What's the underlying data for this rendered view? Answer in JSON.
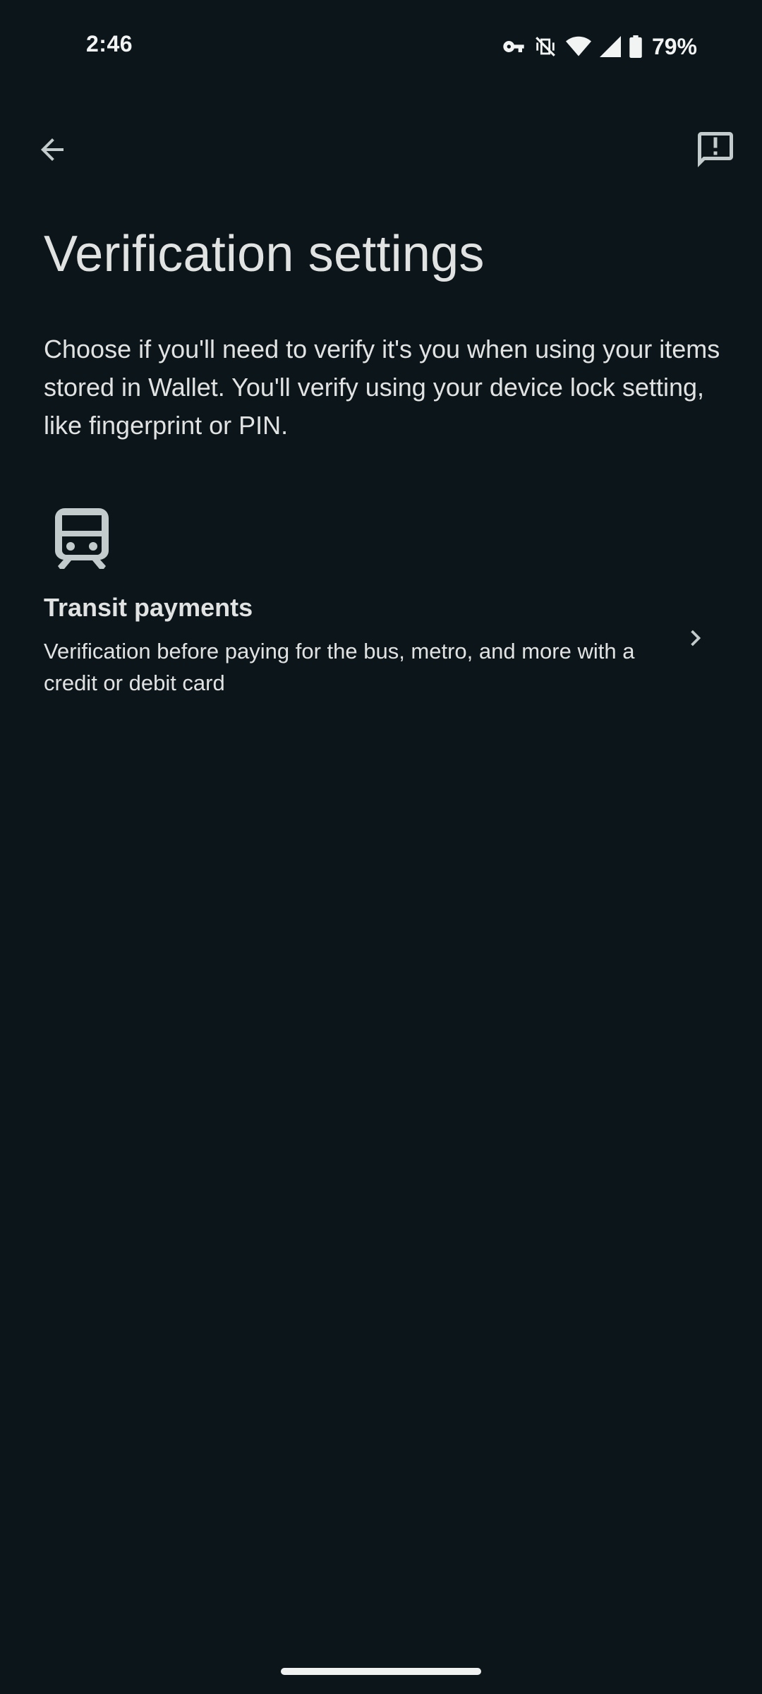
{
  "status_bar": {
    "time": "2:46",
    "battery_percent": "79%",
    "icons": [
      "vpn-key-icon",
      "vibrate-off-icon",
      "wifi-icon",
      "cell-signal-icon",
      "battery-icon"
    ]
  },
  "app_bar": {
    "back_icon": "arrow-back-icon",
    "feedback_icon": "feedback-icon"
  },
  "page": {
    "title": "Verification settings",
    "description": "Choose if you'll need to verify it's you when using your items stored in Wallet. You'll verify using your device lock setting, like fingerprint or PIN."
  },
  "settings": [
    {
      "icon": "train-icon",
      "title": "Transit payments",
      "subtitle": "Verification before paying for the bus, metro, and more with a credit or debit card"
    }
  ],
  "colors": {
    "background": "#0c1519",
    "text": "#e1e3e3",
    "icon": "#c4cbcc"
  }
}
